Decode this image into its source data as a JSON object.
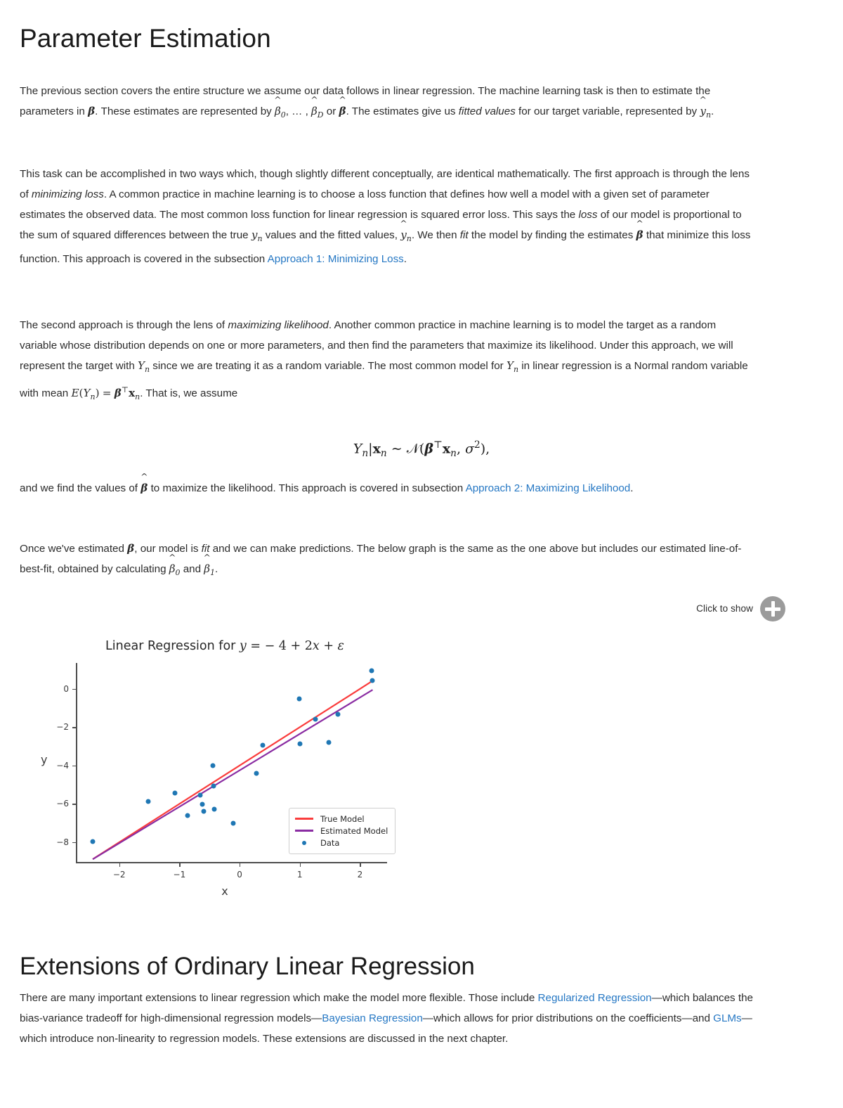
{
  "chapter": {
    "title": "Parameter Estimation"
  },
  "paragraphs": {
    "p1_a": "The previous section covers the entire structure we assume our data follows in linear regression. The machine learning task is then to estimate the parameters in ",
    "p1_b": ". These estimates are represented by ",
    "p1_c": " or ",
    "p1_d": ". The estimates give us ",
    "p1_italic": "fitted values",
    "p1_e": " for our target variable, represented by ",
    "p1_f": ".",
    "p2_a": "This task can be accomplished in two ways which, though slightly different conceptually, are identical mathematically. The first approach is through the lens of ",
    "p2_i1": "minimizing loss",
    "p2_b": ". A common practice in machine learning is to choose a loss function that defines how well a model with a given set of parameter estimates the observed data. The most common loss function for linear regression is squared error loss. This says the ",
    "p2_i2": "loss",
    "p2_c": " of our model is proportional to the sum of squared differences between the true ",
    "p2_d": " values and the fitted values, ",
    "p2_e": ". We then ",
    "p2_i3": "fit",
    "p2_f": " the model by finding the estimates ",
    "p2_g": " that minimize this loss function. This approach is covered in the subsection ",
    "p2_link": "Approach 1: Minimizing Loss",
    "p2_h": ".",
    "p3_a": "The second approach is through the lens of ",
    "p3_i1": "maximizing likelihood",
    "p3_b": ". Another common practice in machine learning is to model the target as a random variable whose distribution depends on one or more parameters, and then find the parameters that maximize its likelihood. Under this approach, we will represent the target with ",
    "p3_c": " since we are treating it as a random variable. The most common model for ",
    "p3_d": " in linear regression is a Normal random variable with mean ",
    "p3_e": ". That is, we assume",
    "p4_a": "and we find the values of ",
    "p4_b": " to maximize the likelihood. This approach is covered in subsection ",
    "p4_link": "Approach 2: Maximizing Likelihood",
    "p4_c": ".",
    "p5_a": "Once we've estimated ",
    "p5_b": ", our model is ",
    "p5_i1": "fit",
    "p5_c": " and we can make predictions. The below graph is the same as the one above but includes our estimated line-of-best-fit, obtained by calculating ",
    "p5_d": " and ",
    "p5_e": "."
  },
  "equation": {
    "display": "Yn|xn ~ N(βᵀxn, σ²),"
  },
  "toggle": {
    "label": "Click to show",
    "icon": "plus-circle-icon"
  },
  "section2": {
    "title": "Extensions of Ordinary Linear Regression",
    "p_a": "There are many important extensions to linear regression which make the model more flexible. Those include ",
    "link1": "Regularized Regression",
    "p_b": "—which balances the bias-variance tradeoff for high-dimensional regression models—",
    "link2": "Bayesian Regression",
    "p_c": "—which allows for prior distributions on the coefficients—and ",
    "link3": "GLMs",
    "p_d": "—which introduce non-linearity to regression models. These extensions are discussed in the next chapter."
  },
  "colors": {
    "link": "#2678c4",
    "true_model": "#fa3c3c",
    "estimated_model": "#8a2ca2",
    "data": "#1f77b4",
    "badge": "#9b9b9b"
  },
  "chart_data": {
    "type": "scatter",
    "title": "Linear Regression for y = − 4 + 2x + ε",
    "xlabel": "x",
    "ylabel": "y",
    "xlim": [
      -2.72,
      2.45
    ],
    "ylim": [
      -9.1,
      1.35
    ],
    "xticks": [
      -2,
      -1,
      0,
      1,
      2
    ],
    "yticks": [
      0,
      -2,
      -4,
      -6,
      -8
    ],
    "grid": false,
    "legend_position": "lower right",
    "legend_entries": [
      "True Model",
      "Estimated Model",
      "Data"
    ],
    "series": [
      {
        "name": "Data",
        "type": "scatter",
        "color": "#1f77b4",
        "points": [
          [
            -2.44,
            -7.97
          ],
          [
            -1.52,
            -5.87
          ],
          [
            -1.07,
            -5.45
          ],
          [
            -0.87,
            -6.6
          ],
          [
            -0.66,
            -5.55
          ],
          [
            -0.62,
            -6.01
          ],
          [
            -0.6,
            -6.37
          ],
          [
            -0.44,
            -3.99
          ],
          [
            -0.43,
            -5.07
          ],
          [
            -0.42,
            -6.29
          ],
          [
            -0.1,
            -7.0
          ],
          [
            0.28,
            -4.39
          ],
          [
            0.39,
            -2.93
          ],
          [
            0.99,
            -0.52
          ],
          [
            1.0,
            -2.88
          ],
          [
            1.26,
            -1.58
          ],
          [
            1.48,
            -2.8
          ],
          [
            1.63,
            -1.32
          ],
          [
            2.19,
            0.95
          ],
          [
            2.21,
            0.42
          ]
        ]
      },
      {
        "name": "True Model",
        "type": "line",
        "color": "#fa3c3c",
        "slope": 2.0,
        "intercept": -4.0,
        "x_range": [
          -2.44,
          2.21
        ]
      },
      {
        "name": "Estimated Model",
        "type": "line",
        "color": "#8a2ca2",
        "slope": 1.9,
        "intercept": -4.25,
        "x_range": [
          -2.44,
          2.21
        ]
      }
    ]
  }
}
